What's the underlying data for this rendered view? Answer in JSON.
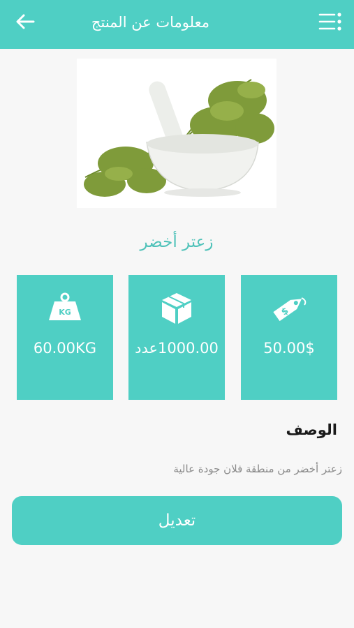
{
  "header": {
    "title": "معلومات عن المنتج",
    "back_icon": "arrow-left-icon",
    "menu_icon": "menu-dots-icon",
    "color": "#4fcfc4"
  },
  "product": {
    "name": "زعتر أخضر",
    "image": "thyme-in-mortar-image"
  },
  "cards": {
    "price": {
      "value": "50.00$",
      "icon": "price-tag-icon"
    },
    "quantity": {
      "value": "1000.00عدد",
      "icon": "box-icon"
    },
    "weight": {
      "value": "60.00KG",
      "icon": "weight-kg-icon"
    }
  },
  "description": {
    "label": "الوصف",
    "text": "زعتر أخضر من منطقة فلان جودة عالية"
  },
  "actions": {
    "edit_label": "تعديل"
  }
}
